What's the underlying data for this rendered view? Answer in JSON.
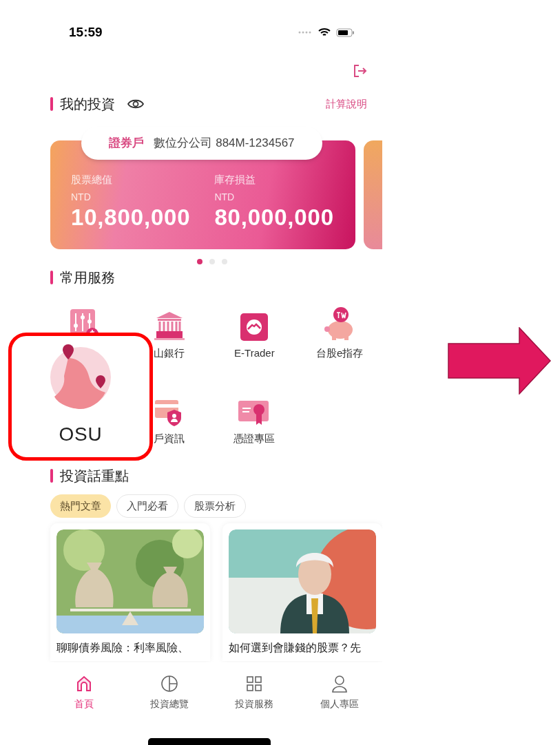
{
  "status_bar": {
    "time": "15:59"
  },
  "my_investment": {
    "title": "我的投資",
    "calc_link": "計算說明"
  },
  "account_card": {
    "account_type": "證券戶",
    "branch": "數位分公司",
    "account_no": "884M-1234567",
    "metrics": [
      {
        "label": "股票總值",
        "currency": "NTD",
        "value": "10,800,000"
      },
      {
        "label": "庫存損益",
        "currency": "NTD",
        "value": "80,000,000"
      }
    ]
  },
  "carousel_dots": [
    {
      "selected": true
    },
    {
      "selected": false
    },
    {
      "selected": false
    }
  ],
  "services": {
    "title": "常用服務",
    "rows": [
      [
        {},
        {
          "label": "山銀行"
        },
        {
          "label": "E-Trader"
        },
        {
          "label": "台股e指存"
        }
      ],
      [
        null,
        {
          "label": "戶資訊"
        },
        {
          "label": "憑證專區"
        }
      ]
    ]
  },
  "highlight_callout": {
    "label": "OSU"
  },
  "articles_section": {
    "title": "投資話重點",
    "tabs": [
      {
        "label": "熱門文章",
        "selected": true
      },
      {
        "label": "入門必看",
        "selected": false
      },
      {
        "label": "股票分析",
        "selected": false
      }
    ],
    "articles": [
      {
        "kind": "picture",
        "title": "聊聊債券風險：利率風險、"
      },
      {
        "kind": "picture",
        "title": "如何選到會賺錢的股票？先"
      }
    ]
  },
  "bottom_nav": [
    {
      "label": "首頁",
      "selected": true
    },
    {
      "label": "投資總覽",
      "selected": false
    },
    {
      "label": "投資服務",
      "selected": false
    },
    {
      "label": "個人專區",
      "selected": false
    }
  ]
}
